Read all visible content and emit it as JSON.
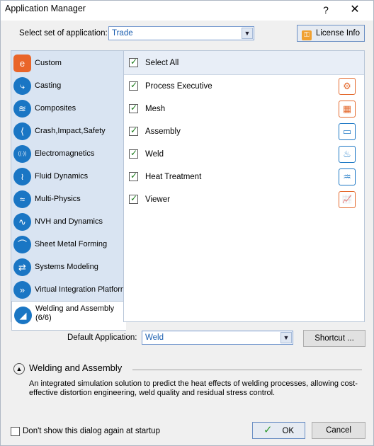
{
  "window": {
    "title": "Application Manager",
    "help_label": "?",
    "close_label": "✕"
  },
  "top": {
    "set_label": "Select set of application:",
    "set_value": "Trade",
    "license_label": "License Info"
  },
  "sidebar": {
    "items": [
      {
        "label": "Custom",
        "icon": "custom-icon",
        "glyph": "e"
      },
      {
        "label": "Casting",
        "icon": "casting-icon",
        "glyph": "⤷"
      },
      {
        "label": "Composites",
        "icon": "composites-icon",
        "glyph": "≋"
      },
      {
        "label": "Crash,Impact,Safety",
        "icon": "crash-icon",
        "glyph": "⟨"
      },
      {
        "label": "Electromagnetics",
        "icon": "electromagnetics-icon",
        "glyph": "((·))"
      },
      {
        "label": "Fluid Dynamics",
        "icon": "fluid-dynamics-icon",
        "glyph": "≀"
      },
      {
        "label": "Multi-Physics",
        "icon": "multi-physics-icon",
        "glyph": "≈"
      },
      {
        "label": "NVH and Dynamics",
        "icon": "nvh-icon",
        "glyph": "∿"
      },
      {
        "label": "Sheet Metal Forming",
        "icon": "sheet-metal-icon",
        "glyph": "⌒"
      },
      {
        "label": "Systems Modeling",
        "icon": "systems-modeling-icon",
        "glyph": "⇄"
      },
      {
        "label": "Virtual Integration Platform",
        "icon": "virtual-integration-icon",
        "glyph": "»"
      },
      {
        "label_line1": "Welding and Assembly",
        "label_line2": "(6/6)",
        "icon": "welding-assembly-icon",
        "glyph": "◢",
        "selected": true
      }
    ]
  },
  "panel": {
    "header": "Select All",
    "rows": [
      {
        "label": "Process Executive",
        "checked": true,
        "icon": "process-executive-icon",
        "glyph": "⚙"
      },
      {
        "label": "Mesh",
        "checked": true,
        "icon": "mesh-icon",
        "glyph": "▦"
      },
      {
        "label": "Assembly",
        "checked": true,
        "icon": "assembly-icon",
        "glyph": "▭"
      },
      {
        "label": "Weld",
        "checked": true,
        "icon": "weld-icon",
        "glyph": "♨"
      },
      {
        "label": "Heat Treatment",
        "checked": true,
        "icon": "heat-treatment-icon",
        "glyph": "♒"
      },
      {
        "label": "Viewer",
        "checked": true,
        "icon": "viewer-icon",
        "glyph": "📈"
      }
    ]
  },
  "default_app": {
    "label": "Default Application:",
    "value": "Weld",
    "shortcut_label": "Shortcut ..."
  },
  "section": {
    "title": "Welding and Assembly",
    "description": "An integrated simulation solution to predict the heat effects of welding processes, allowing cost-effective distortion engineering, weld quality and residual stress control."
  },
  "footer": {
    "dont_show_label": "Don't show this dialog again at startup",
    "ok_label": "OK",
    "cancel_label": "Cancel"
  },
  "colors": {
    "accent_blue": "#1a76c4",
    "accent_orange": "#e46a2e",
    "check_green": "#1a7a1a"
  }
}
